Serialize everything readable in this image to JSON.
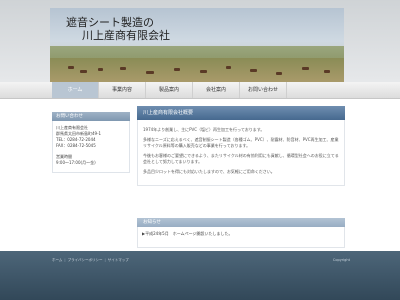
{
  "header": {
    "title_line1": "遮音シート製造の",
    "title_line2": "川上産商有限会社"
  },
  "nav": [
    {
      "label": "ホーム"
    },
    {
      "label": "事業内容"
    },
    {
      "label": "製品案内"
    },
    {
      "label": "会社案内"
    },
    {
      "label": "お問い合わせ"
    }
  ],
  "sidebar": {
    "heading": "お問い合わせ",
    "company": "川上産商有限会社",
    "address": "群馬県太田市新島町49-1",
    "tel": "TEL：0284-72-2044",
    "fax": "FAX：0284-72-5045",
    "hours_title": "営業時間",
    "hours": "9:00～17:00(月～金)"
  },
  "content": {
    "heading": "川上産商有限会社概要",
    "p1": "1974年より創業し、主にPVC（塩ビ）再生加工を行っております。",
    "p2": "多様なニーズに応えるべく、遮音制振シート製造（各種ゴム、PVC）、耐震材、防音材、PVC再生加工、産業リサイクル原料等の購入販売などの事業を行っております。",
    "p3": "今後もお客様のご要望にできるよう、またリサイクル材の有効利用にも貢献し、循環型社会へのお役に立てる会社として努力してまいります。",
    "p4": "多品目少ロットを得にも対応いたしますので、お気軽にご用命ください。"
  },
  "news": {
    "heading": "お知らせ",
    "item": "▶平成24年5月　ホームページ開設いたしました。"
  },
  "footer": {
    "links": [
      "ホーム",
      "プライバシーポリシー",
      "サイトマップ"
    ],
    "copyright": "Copyright"
  }
}
